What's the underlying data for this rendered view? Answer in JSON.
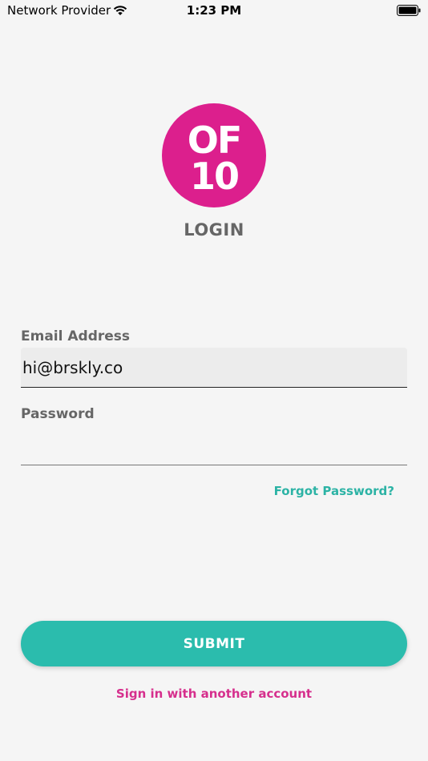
{
  "status_bar": {
    "carrier": "Network Provider",
    "time": "1:23 PM",
    "wifi_icon": "wifi-icon",
    "battery_icon": "battery-icon"
  },
  "logo": {
    "top_text": "OF",
    "bottom_text": "10",
    "color": "#dc1f8d"
  },
  "page": {
    "title": "LOGIN"
  },
  "form": {
    "email_label": "Email Address",
    "email_value": "hi@brskly.co",
    "password_label": "Password",
    "password_value": "",
    "forgot_label": "Forgot Password?",
    "submit_label": "SUBMIT"
  },
  "footer": {
    "alt_signin_label": "Sign in with another account"
  },
  "colors": {
    "accent": "#2bbcad",
    "link": "#2cb3a5",
    "brand": "#dc1f8d",
    "alt_link": "#d62f8d"
  }
}
